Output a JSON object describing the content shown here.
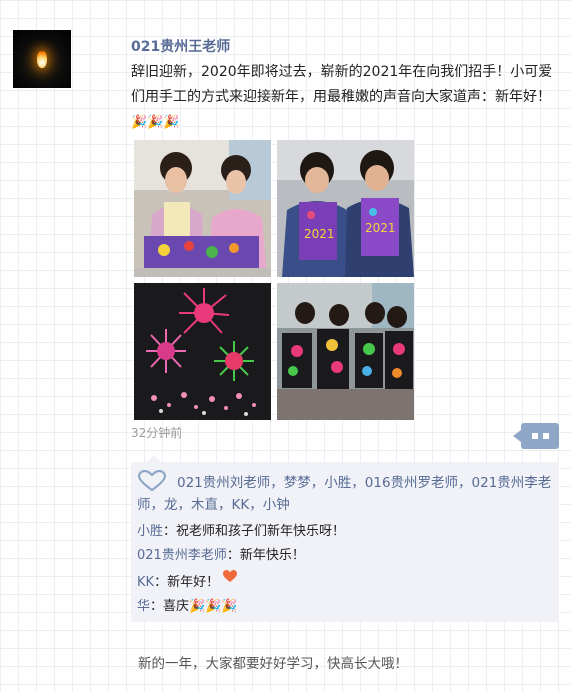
{
  "post": {
    "username": "021贵州王老师",
    "text": "辞旧迎新，2020年即将过去，崭新的2021年在向我们招手！小可爱们用手工的方式来迎接新年，用最稚嫩的声音向大家道声：新年好！",
    "text_emoji": "🎉🎉🎉",
    "timestamp": "32分钟前"
  },
  "photos": [
    {
      "alt": "two girls with clay craft"
    },
    {
      "alt": "two girls holding 2021 cards"
    },
    {
      "alt": "firework paper art"
    },
    {
      "alt": "children holding firework artworks"
    }
  ],
  "likes": {
    "icon": "heart-outline-icon",
    "names": "021贵州刘老师，梦梦，小胜，016贵州罗老师，021贵州李老师，龙，木直，KK，小钟"
  },
  "comments": [
    {
      "author": "小胜",
      "separator": "：",
      "text": "祝老师和孩子们新年快乐呀！",
      "emoji": ""
    },
    {
      "author": "021贵州李老师",
      "separator": "：",
      "text": "新年快乐！",
      "emoji": ""
    },
    {
      "author": "KK",
      "separator": "：",
      "text": "新年好！",
      "emoji": "heart"
    },
    {
      "author": "华",
      "separator": "：",
      "text": "喜庆",
      "emoji": "🎉🎉🎉"
    }
  ],
  "footer_text": "新的一年，大家都要好好学习，快高长大哦！",
  "colors": {
    "link": "#576b95",
    "more_button": "#8fa7c6",
    "comment_bg": "#f1f2f7"
  }
}
